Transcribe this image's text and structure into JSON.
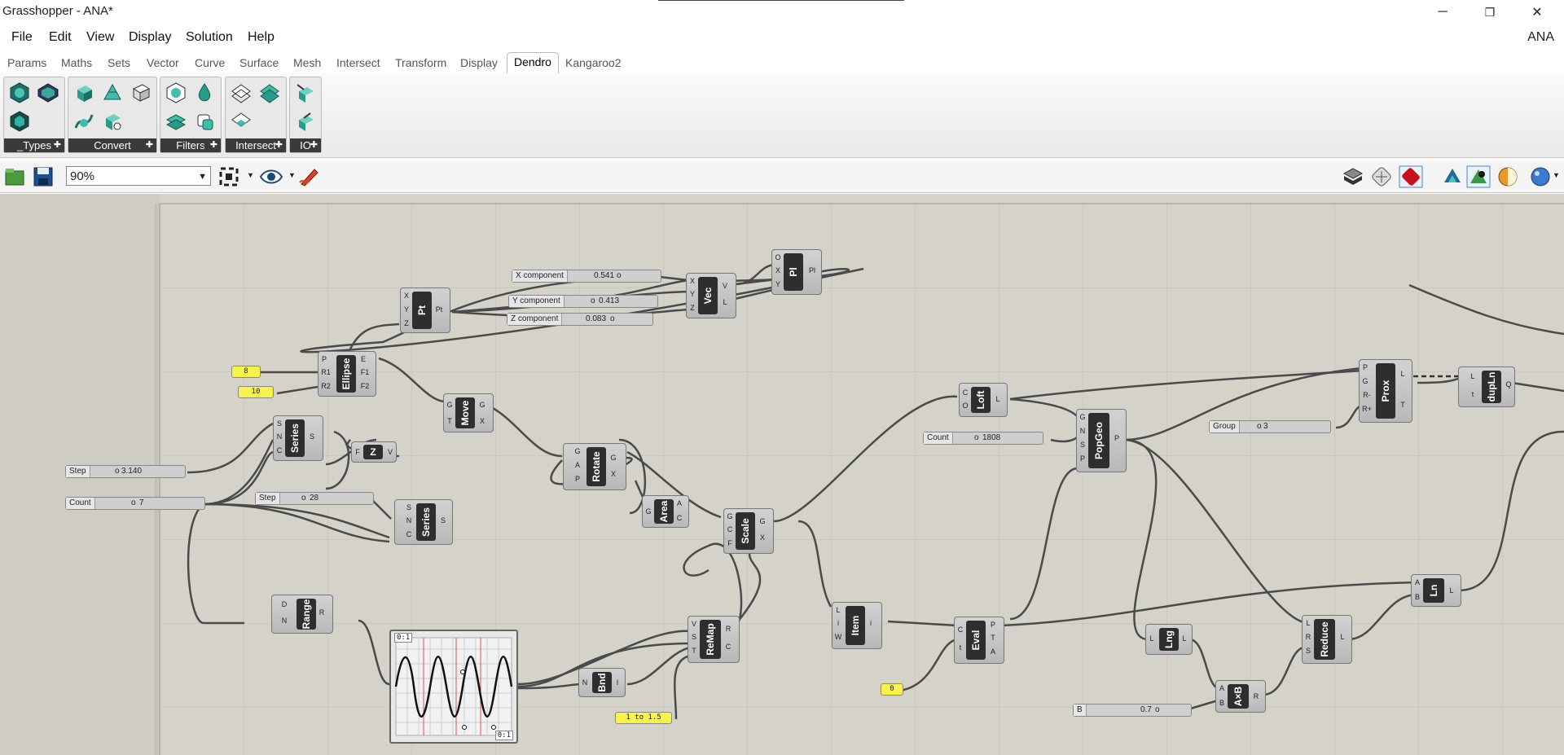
{
  "window": {
    "title": "Grasshopper - ANA*",
    "min": "─",
    "max": "❐",
    "close": "✕"
  },
  "menu": {
    "items": [
      "File",
      "Edit",
      "View",
      "Display",
      "Solution",
      "Help"
    ],
    "right_label": "ANA"
  },
  "tabs": [
    "Params",
    "Maths",
    "Sets",
    "Vector",
    "Curve",
    "Surface",
    "Mesh",
    "Intersect",
    "Transform",
    "Display",
    "Dendro",
    "Kangaroo2"
  ],
  "active_tab": "Dendro",
  "ribbon_panels": [
    "_Types",
    "Convert",
    "Filters",
    "Intersect",
    "IO"
  ],
  "zoom": "90%",
  "canvas": {
    "components": {
      "pt": "Pt",
      "vec": "Vec",
      "pl": "Pl",
      "ellipse": "Ellipse",
      "move": "Move",
      "series1": "Series",
      "z": "Z",
      "rotate": "Rotate",
      "series2": "Series",
      "area": "Area",
      "scale": "Scale",
      "range": "Range",
      "bnd": "Bnd",
      "remap": "ReMap",
      "item": "Item",
      "eval": "Eval",
      "loft": "Loft",
      "popgeo": "PopGeo",
      "prox": "Prox",
      "dupln": "dupLn",
      "lng": "Lng",
      "reduce": "Reduce",
      "ln": "Ln",
      "axb": "A×B"
    },
    "sliders": {
      "x_comp": {
        "label": "X component",
        "value": "0.541"
      },
      "y_comp": {
        "label": "Y component",
        "value": "0.413"
      },
      "z_comp": {
        "label": "Z component",
        "value": "0.083"
      },
      "step1": {
        "label": "Step",
        "value": "3.140"
      },
      "count1": {
        "label": "Count",
        "value": "7"
      },
      "step2": {
        "label": "Step",
        "value": "28"
      },
      "count2": {
        "label": "Count",
        "value": "1808"
      },
      "group": {
        "label": "Group",
        "value": "3"
      },
      "b": {
        "label": "B",
        "value": "0.7"
      }
    },
    "panels": {
      "p8": "8",
      "p10": "10",
      "p0": "0",
      "remap_range": "1 to 1.5"
    },
    "graph": {
      "top_label": "0:1",
      "bottom_label": "0:1"
    }
  },
  "colors": {
    "canvas": "#d5d2ca",
    "panel_yellow": "#f7f34a",
    "component_core": "#2e2e2e"
  }
}
